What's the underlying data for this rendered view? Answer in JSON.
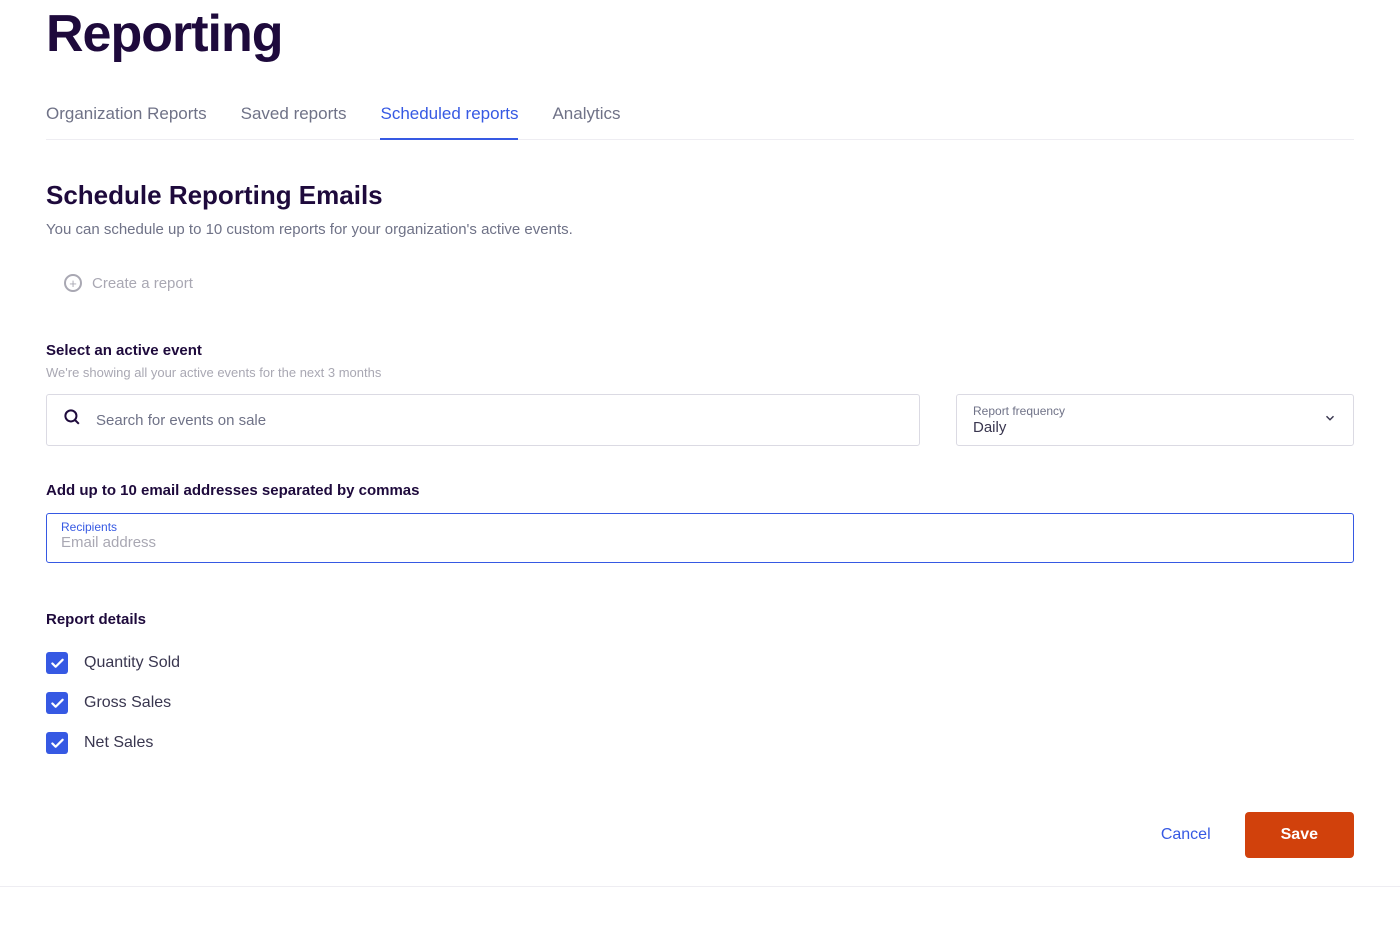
{
  "page": {
    "title": "Reporting"
  },
  "tabs": [
    {
      "label": "Organization Reports",
      "active": false
    },
    {
      "label": "Saved reports",
      "active": false
    },
    {
      "label": "Scheduled reports",
      "active": true
    },
    {
      "label": "Analytics",
      "active": false
    }
  ],
  "schedule": {
    "heading": "Schedule Reporting Emails",
    "subtext": "You can schedule up to 10 custom reports for your organization's active events.",
    "create_label": "Create a report"
  },
  "events": {
    "label": "Select an active event",
    "hint": "We're showing all your active events for the next 3 months",
    "search_placeholder": "Search for events on sale"
  },
  "frequency": {
    "label": "Report frequency",
    "value": "Daily"
  },
  "recipients": {
    "section_label": "Add up to 10 email addresses separated by commas",
    "floating_label": "Recipients",
    "placeholder": "Email address",
    "value": ""
  },
  "details": {
    "heading": "Report details",
    "options": [
      {
        "label": "Quantity Sold",
        "checked": true
      },
      {
        "label": "Gross Sales",
        "checked": true
      },
      {
        "label": "Net Sales",
        "checked": true
      }
    ]
  },
  "actions": {
    "cancel": "Cancel",
    "save": "Save"
  }
}
